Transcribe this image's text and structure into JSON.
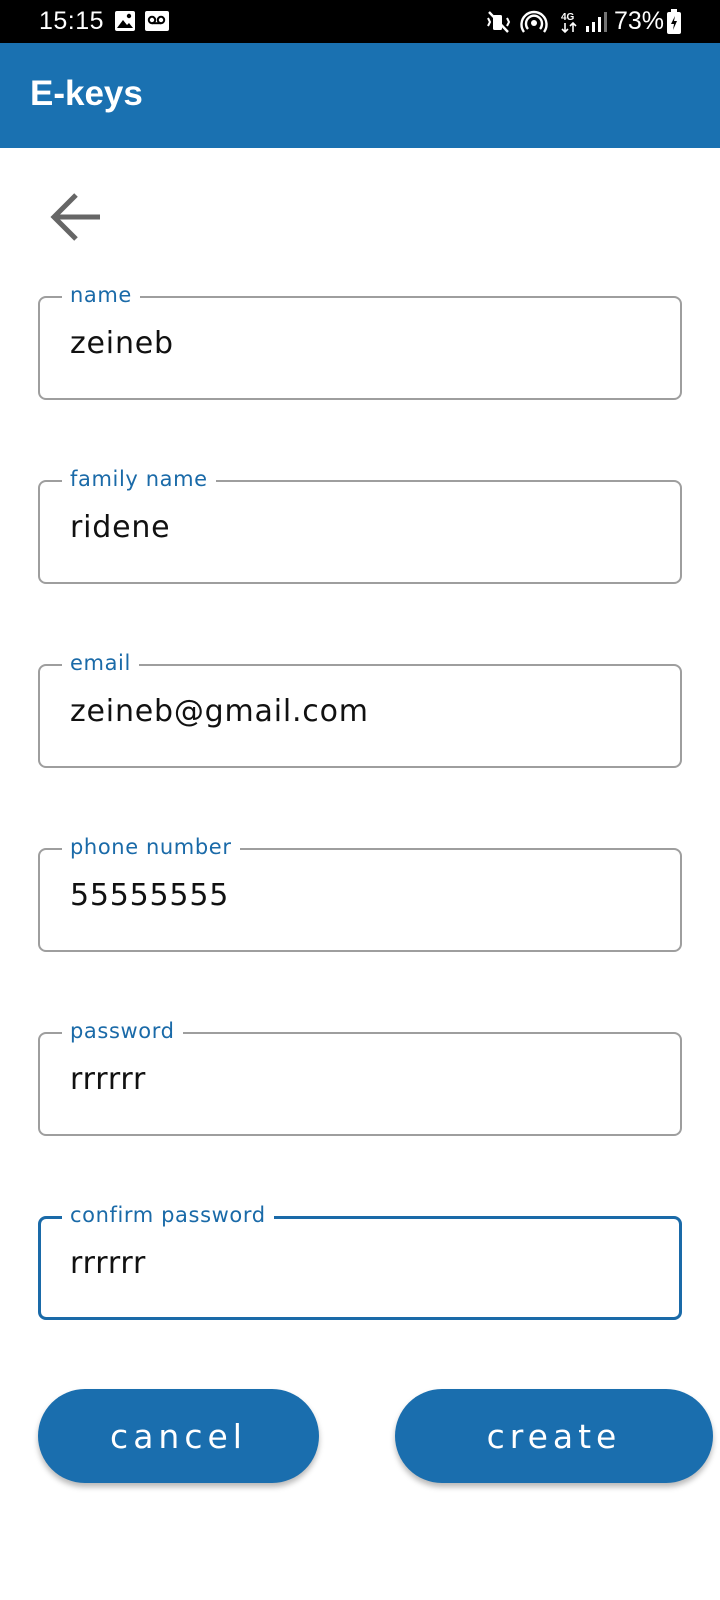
{
  "status_bar": {
    "time": "15:15",
    "battery": "73%",
    "icons": [
      "image-icon",
      "voicemail-icon",
      "mute-icon",
      "hotspot-icon",
      "network-4g-icon",
      "signal-icon",
      "battery-icon"
    ]
  },
  "app_bar": {
    "title": "E-keys"
  },
  "back_icon": "arrow-left-icon",
  "form": {
    "fields": [
      {
        "label": "name",
        "value": "zeineb"
      },
      {
        "label": "family name",
        "value": "ridene"
      },
      {
        "label": "email",
        "value": "zeineb@gmail.com"
      },
      {
        "label": "phone number",
        "value": "55555555"
      },
      {
        "label": "password",
        "value": "rrrrrr"
      },
      {
        "label": "confirm password",
        "value": "rrrrrr"
      }
    ]
  },
  "buttons": {
    "cancel": "cancel",
    "create": "create"
  },
  "colors": {
    "primary": "#1a71b1",
    "label": "#1a6aa8",
    "border": "#9e9e9e"
  }
}
